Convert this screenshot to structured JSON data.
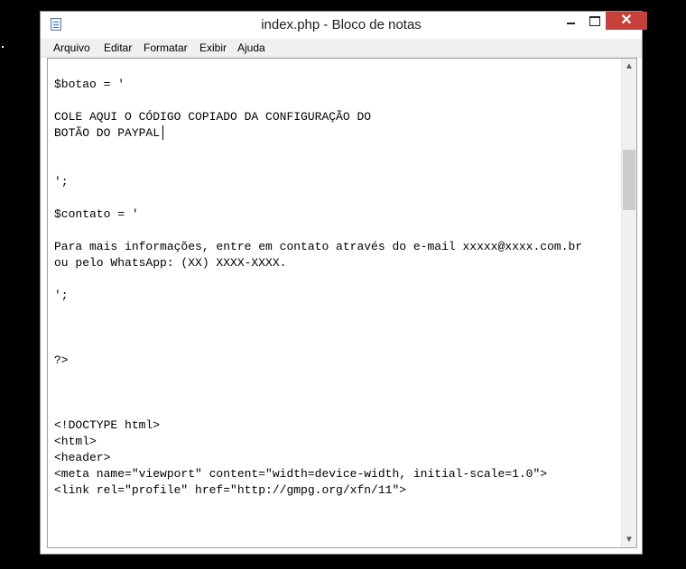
{
  "window": {
    "title": "index.php - Bloco de notas",
    "close_symbol": "✕"
  },
  "menu": [
    "Arquivo",
    "Editar",
    "Formatar",
    "Exibir",
    "Ajuda"
  ],
  "editor": {
    "lines": [
      "$botao = '",
      "",
      "COLE AQUI O CÓDIGO COPIADO DA CONFIGURAÇÃO DO",
      "BOTÃO DO PAYPAL",
      "",
      "",
      "';",
      "",
      "$contato = '",
      "",
      "Para mais informações, entre em contato através do e-mail xxxxx@xxxx.com.br",
      "ou pelo WhatsApp: (XX) XXXX-XXXX.",
      "",
      "';",
      "",
      "",
      "",
      "?>",
      "",
      "",
      "",
      "<!DOCTYPE html>",
      "<html>",
      "<header>",
      "<meta name=\"viewport\" content=\"width=device-width, initial-scale=1.0\">",
      "<link rel=\"profile\" href=\"http://gmpg.org/xfn/11\">"
    ]
  },
  "scrollbar": {
    "up_symbol": "▲",
    "down_symbol": "▼"
  },
  "icons": [
    "notepad-icon",
    "minimize-icon",
    "maximize-icon",
    "close-icon",
    "scroll-up-icon",
    "scroll-down-icon"
  ]
}
